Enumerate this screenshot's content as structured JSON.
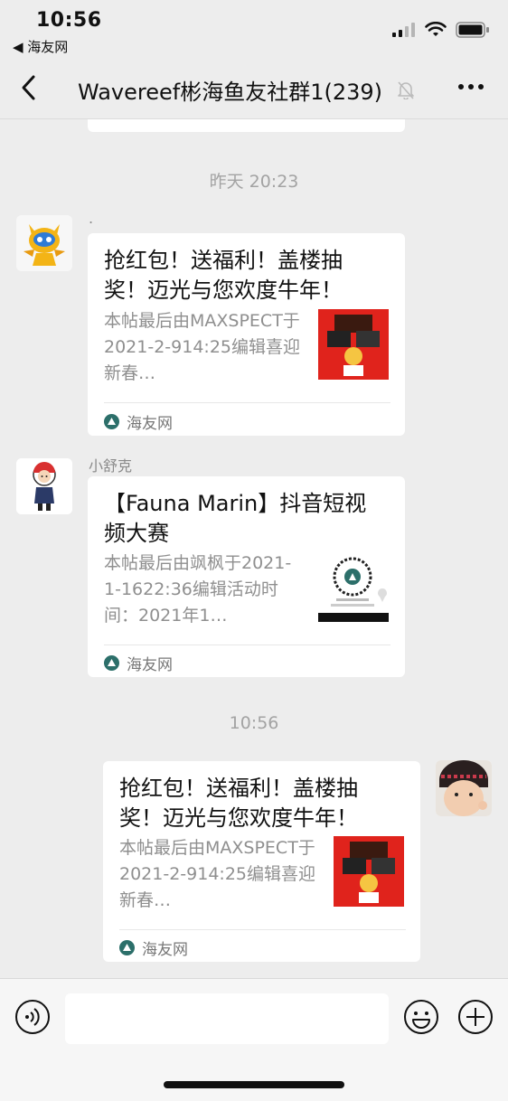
{
  "status_bar": {
    "time": "10:56",
    "back_app": "◀ 海友网"
  },
  "nav": {
    "title": "Wavereef彬海鱼友社群1(239)",
    "muted": true
  },
  "messages": [
    {
      "type": "timestamp",
      "text": "昨天 20:23"
    },
    {
      "type": "card",
      "side": "left",
      "sender": ".",
      "title": "抢红包！送福利！盖楼抽奖！迈光与您欢度牛年！",
      "desc": "本帖最后由MAXSPECT于2021-2-914:25编辑喜迎新春…",
      "source": "海友网"
    },
    {
      "type": "card",
      "side": "left",
      "sender": "小舒克",
      "title": "【Fauna Marin】抖音短视频大赛",
      "desc": "本帖最后由飒枫于2021-1-1622:36编辑活动时间：2021年1…",
      "source": "海友网"
    },
    {
      "type": "timestamp",
      "text": "10:56"
    },
    {
      "type": "card",
      "side": "right",
      "title": "抢红包！送福利！盖楼抽奖！迈光与您欢度牛年！",
      "desc": "本帖最后由MAXSPECT于2021-2-914:25编辑喜迎新春…",
      "source": "海友网"
    }
  ],
  "colors": {
    "background": "#ededed",
    "card": "#ffffff",
    "timestamp": "#a3a3a3",
    "thumb_red": "#e0231c"
  }
}
